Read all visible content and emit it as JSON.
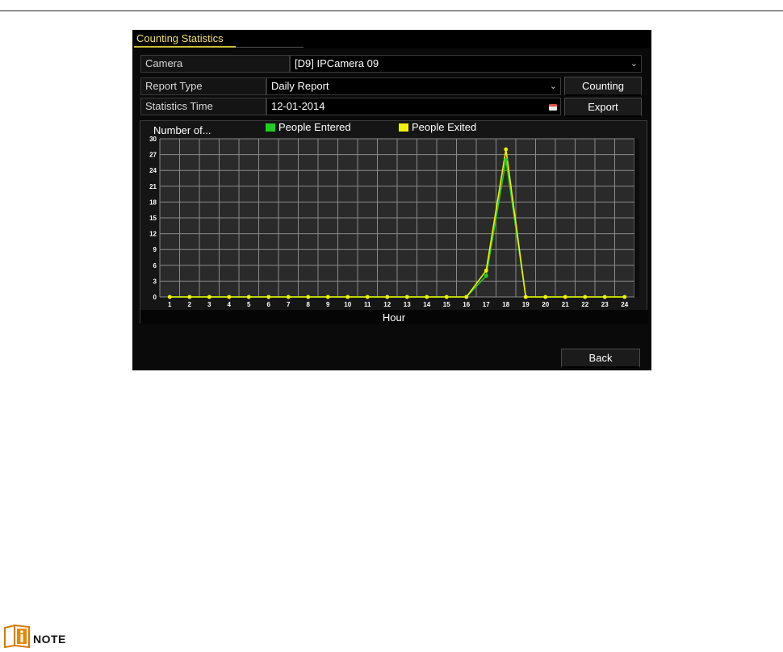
{
  "window": {
    "tab_label": "Counting Statistics"
  },
  "form": {
    "camera_label": "Camera",
    "camera_value": "[D9] IPCamera 09",
    "report_type_label": "Report Type",
    "report_type_value": "Daily Report",
    "statistics_time_label": "Statistics Time",
    "statistics_time_value": "12-01-2014"
  },
  "buttons": {
    "counting": "Counting",
    "export": "Export",
    "back": "Back"
  },
  "chart_data": {
    "type": "line",
    "title": "",
    "ylabel": "Number of...",
    "xlabel": "Hour",
    "x": [
      1,
      2,
      3,
      4,
      5,
      6,
      7,
      8,
      9,
      10,
      11,
      12,
      13,
      14,
      15,
      16,
      17,
      18,
      19,
      20,
      21,
      22,
      23,
      24
    ],
    "ylim": [
      0,
      30
    ],
    "yticks": [
      0,
      3,
      6,
      9,
      12,
      15,
      18,
      21,
      24,
      27,
      30
    ],
    "grid": true,
    "legend_placement": "top",
    "series": [
      {
        "name": "People Entered",
        "color": "#22cc22",
        "values": [
          0,
          0,
          0,
          0,
          0,
          0,
          0,
          0,
          0,
          0,
          0,
          0,
          0,
          0,
          0,
          0,
          4,
          26,
          0,
          0,
          0,
          0,
          0,
          0
        ]
      },
      {
        "name": "People Exited",
        "color": "#f2f200",
        "values": [
          0,
          0,
          0,
          0,
          0,
          0,
          0,
          0,
          0,
          0,
          0,
          0,
          0,
          0,
          0,
          0,
          5,
          28,
          0,
          0,
          0,
          0,
          0,
          0
        ]
      }
    ]
  },
  "note": {
    "label": "NOTE",
    "icon": "info-icon"
  }
}
